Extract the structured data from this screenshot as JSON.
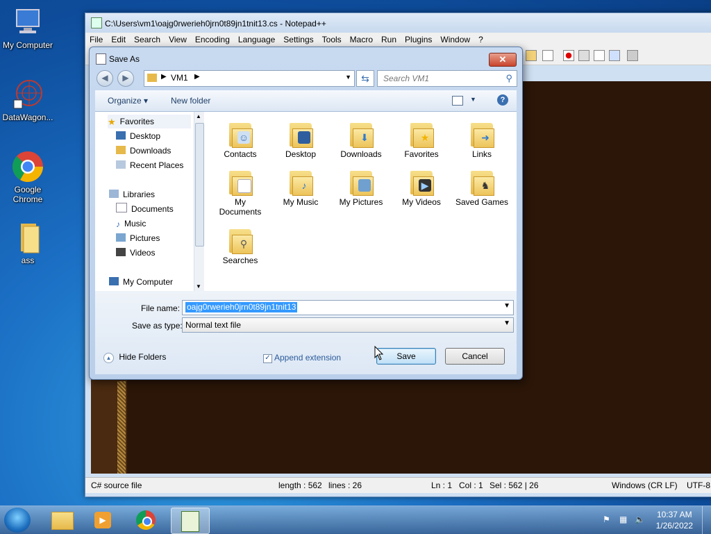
{
  "desktop": {
    "icons": [
      {
        "label": "My Computer"
      },
      {
        "label": "DataWagon..."
      },
      {
        "label": "Google Chrome"
      },
      {
        "label": "ass"
      }
    ]
  },
  "notepad": {
    "title": "C:\\Users\\vm1\\oajg0rwerieh0jrn0t89jn1tnit13.cs - Notepad++",
    "menu": [
      "File",
      "Edit",
      "Search",
      "View",
      "Encoding",
      "Language",
      "Settings",
      "Tools",
      "Macro",
      "Run",
      "Plugins",
      "Window",
      "?"
    ],
    "status": {
      "file_type": "C# source file",
      "length": "length : 562",
      "lines": "lines : 26",
      "ln": "Ln : 1",
      "col": "Col : 1",
      "sel": "Sel : 562 | 26",
      "eol": "Windows (CR LF)",
      "encoding": "UTF-8"
    }
  },
  "dialog": {
    "title": "Save As",
    "close": "✕",
    "address": {
      "path": "VM1"
    },
    "search": {
      "placeholder": "Search VM1"
    },
    "toolbar": {
      "organize": "Organize",
      "new_folder": "New folder",
      "help": "?"
    },
    "nav": {
      "favorites": "Favorites",
      "desktop": "Desktop",
      "downloads": "Downloads",
      "recent": "Recent Places",
      "libraries": "Libraries",
      "documents": "Documents",
      "music": "Music",
      "pictures": "Pictures",
      "videos": "Videos",
      "computer": "My Computer"
    },
    "folders": [
      {
        "label": "Contacts"
      },
      {
        "label": "Desktop"
      },
      {
        "label": "Downloads"
      },
      {
        "label": "Favorites"
      },
      {
        "label": "Links"
      },
      {
        "label": "My Documents"
      },
      {
        "label": "My Music"
      },
      {
        "label": "My Pictures"
      },
      {
        "label": "My Videos"
      },
      {
        "label": "Saved Games"
      },
      {
        "label": "Searches"
      }
    ],
    "file_name_label": "File name:",
    "file_name_value": "oajg0rwerieh0jrn0t89jn1tnit13",
    "save_type_label": "Save as type:",
    "save_type_value": "Normal text file",
    "hide_folders": "Hide Folders",
    "append_extension": "Append extension",
    "append_checked": true,
    "save_button": "Save",
    "cancel_button": "Cancel"
  },
  "taskbar": {
    "time": "10:37 AM",
    "date": "1/26/2022"
  }
}
